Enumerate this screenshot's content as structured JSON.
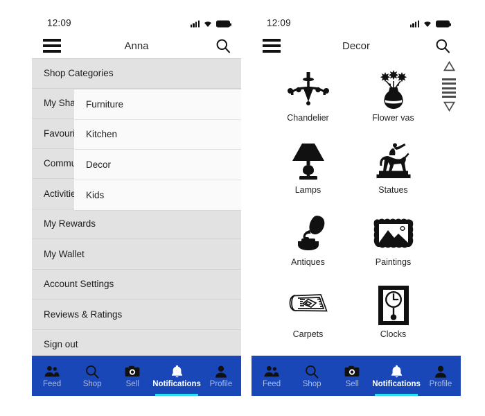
{
  "left_phone": {
    "status": {
      "time": "12:09",
      "signal_icon": "signal-bars-icon",
      "wifi_icon": "wifi-icon",
      "battery_icon": "battery-icon"
    },
    "appbar": {
      "title": "Anna",
      "menu_icon": "hamburger-menu-icon",
      "search_icon": "search-icon"
    },
    "drawer": {
      "items": [
        {
          "label": "Shop Categories"
        },
        {
          "label": "My Shares"
        },
        {
          "label": "Favourites"
        },
        {
          "label": "Community"
        },
        {
          "label": "Activities"
        },
        {
          "label": "My Rewards"
        },
        {
          "label": "My Wallet"
        },
        {
          "label": "Account Settings"
        },
        {
          "label": "Reviews & Ratings"
        },
        {
          "label": "Sign out"
        }
      ]
    },
    "submenu": {
      "items": [
        {
          "label": "Furniture"
        },
        {
          "label": "Kitchen"
        },
        {
          "label": "Decor"
        },
        {
          "label": "Kids"
        }
      ]
    },
    "bottom_nav": {
      "items": [
        {
          "label": "Feed",
          "icon": "people-icon",
          "active": false
        },
        {
          "label": "Shop",
          "icon": "search-icon",
          "active": false
        },
        {
          "label": "Sell",
          "icon": "camera-icon",
          "active": false
        },
        {
          "label": "Notifications",
          "icon": "bell-icon",
          "active": true
        },
        {
          "label": "Profile",
          "icon": "person-icon",
          "active": false
        }
      ]
    }
  },
  "right_phone": {
    "status": {
      "time": "12:09",
      "signal_icon": "signal-bars-icon",
      "wifi_icon": "wifi-icon",
      "battery_icon": "battery-icon"
    },
    "appbar": {
      "title": "Decor",
      "menu_icon": "hamburger-menu-icon",
      "search_icon": "search-icon"
    },
    "grid": {
      "items": [
        {
          "label": "Chandelier",
          "icon": "chandelier-icon"
        },
        {
          "label": "Flower vas",
          "icon": "flower-vase-icon"
        },
        {
          "label": "Lamps",
          "icon": "table-lamp-icon"
        },
        {
          "label": "Statues",
          "icon": "equestrian-statue-icon"
        },
        {
          "label": "Antiques",
          "icon": "gramophone-icon"
        },
        {
          "label": "Paintings",
          "icon": "framed-picture-icon"
        },
        {
          "label": "Carpets",
          "icon": "rolled-carpet-icon"
        },
        {
          "label": "Clocks",
          "icon": "grandfather-clock-icon"
        }
      ]
    },
    "scrollbar": {
      "up_icon": "triangle-up-icon",
      "down_icon": "triangle-down-icon",
      "grip_icon": "scrollbar-grip-icon"
    },
    "bottom_nav": {
      "items": [
        {
          "label": "Feed",
          "icon": "people-icon",
          "active": false
        },
        {
          "label": "Shop",
          "icon": "search-icon",
          "active": false
        },
        {
          "label": "Sell",
          "icon": "camera-icon",
          "active": false
        },
        {
          "label": "Notifications",
          "icon": "bell-icon",
          "active": true
        },
        {
          "label": "Profile",
          "icon": "person-icon",
          "active": false
        }
      ]
    }
  },
  "colors": {
    "nav_blue": "#1a47b8",
    "active_underline": "#27e0f5",
    "drawer_gray": "#e2e2e2",
    "submenu_white": "#fafafa",
    "icon_black": "#111111"
  }
}
